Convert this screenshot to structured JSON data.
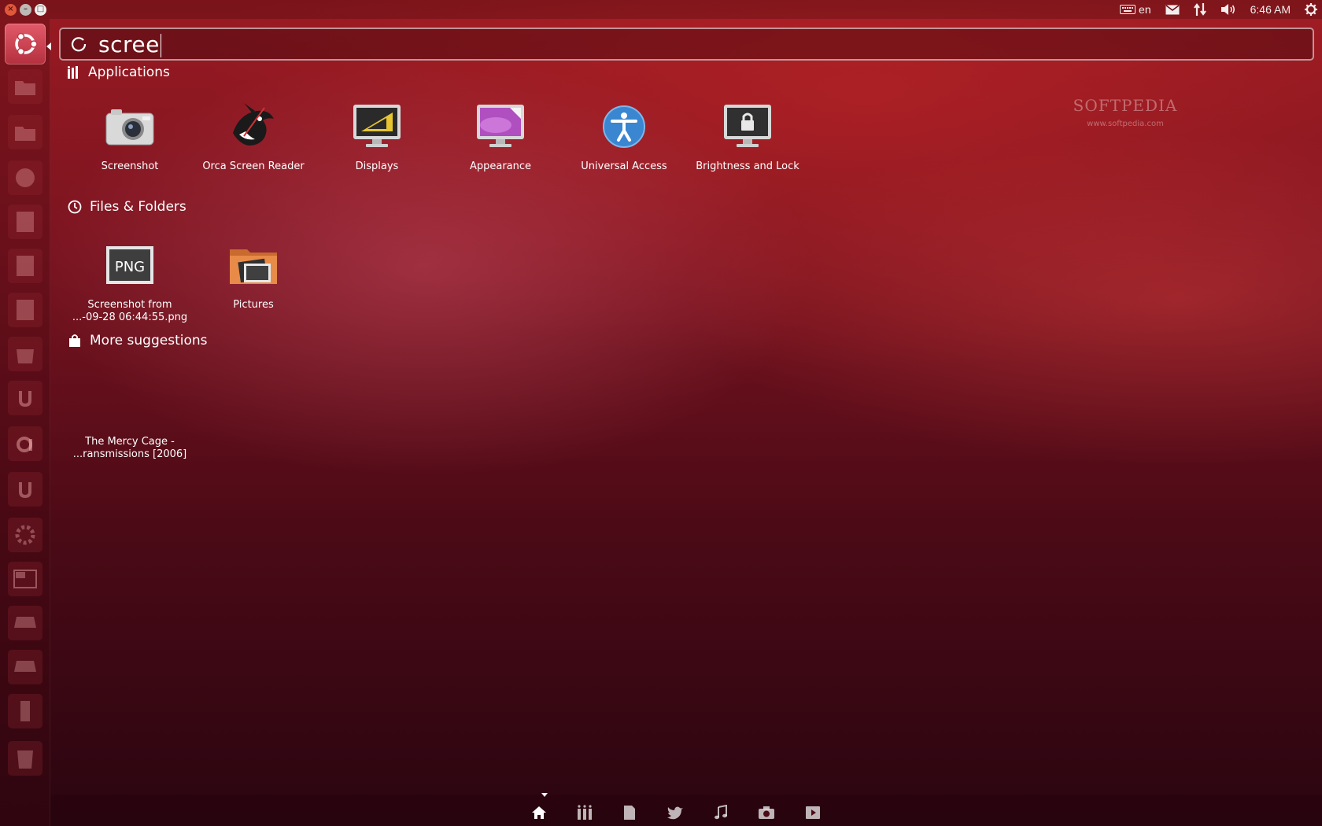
{
  "top_panel": {
    "keyboard_layout": "en",
    "clock": "6:46 AM",
    "icons": [
      "keyboard-icon",
      "mail-icon",
      "network-icon",
      "volume-icon",
      "power-icon"
    ]
  },
  "search": {
    "query": "scree"
  },
  "categories": {
    "applications": "Applications",
    "files_folders": "Files & Folders",
    "more_suggestions": "More suggestions"
  },
  "applications": [
    {
      "label": "Screenshot",
      "icon": "camera-icon"
    },
    {
      "label": "Orca Screen Reader",
      "icon": "orca-icon"
    },
    {
      "label": "Displays",
      "icon": "displays-icon"
    },
    {
      "label": "Appearance",
      "icon": "appearance-icon"
    },
    {
      "label": "Universal Access",
      "icon": "universal-access-icon"
    },
    {
      "label": "Brightness and Lock",
      "icon": "brightness-lock-icon"
    }
  ],
  "files": [
    {
      "label_line1": "Screenshot from",
      "label_line2": "...-09-28 06:44:55.png",
      "icon": "png-file-icon",
      "icon_text": "PNG"
    },
    {
      "label_line1": "Pictures",
      "label_line2": "",
      "icon": "pictures-folder-icon"
    }
  ],
  "suggestions": [
    {
      "label_line1": "The Mercy Cage -",
      "label_line2": "...ransmissions [2006]"
    }
  ],
  "watermark": {
    "title": "SOFTPEDIA",
    "url": "www.softpedia.com"
  },
  "lenses": [
    "home-lens-icon",
    "applications-lens-icon",
    "files-lens-icon",
    "social-lens-icon",
    "music-lens-icon",
    "photos-lens-icon",
    "video-lens-icon"
  ],
  "colors": {
    "accent": "#b4303f",
    "background": "#7a1420"
  }
}
